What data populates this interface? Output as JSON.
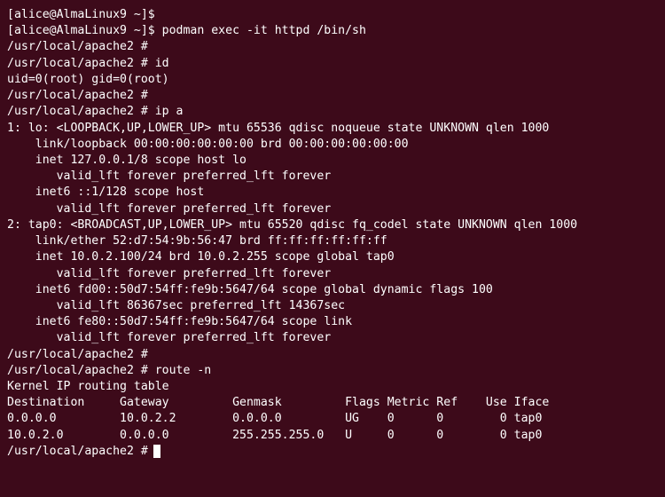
{
  "lines": [
    "[alice@AlmaLinux9 ~]$",
    "[alice@AlmaLinux9 ~]$ podman exec -it httpd /bin/sh",
    "/usr/local/apache2 #",
    "/usr/local/apache2 # id",
    "uid=0(root) gid=0(root)",
    "/usr/local/apache2 #",
    "/usr/local/apache2 # ip a",
    "1: lo: <LOOPBACK,UP,LOWER_UP> mtu 65536 qdisc noqueue state UNKNOWN qlen 1000",
    "    link/loopback 00:00:00:00:00:00 brd 00:00:00:00:00:00",
    "    inet 127.0.0.1/8 scope host lo",
    "       valid_lft forever preferred_lft forever",
    "    inet6 ::1/128 scope host",
    "       valid_lft forever preferred_lft forever",
    "2: tap0: <BROADCAST,UP,LOWER_UP> mtu 65520 qdisc fq_codel state UNKNOWN qlen 1000",
    "    link/ether 52:d7:54:9b:56:47 brd ff:ff:ff:ff:ff:ff",
    "    inet 10.0.2.100/24 brd 10.0.2.255 scope global tap0",
    "       valid_lft forever preferred_lft forever",
    "    inet6 fd00::50d7:54ff:fe9b:5647/64 scope global dynamic flags 100",
    "       valid_lft 86367sec preferred_lft 14367sec",
    "    inet6 fe80::50d7:54ff:fe9b:5647/64 scope link",
    "       valid_lft forever preferred_lft forever",
    "/usr/local/apache2 #",
    "/usr/local/apache2 # route -n",
    "Kernel IP routing table",
    "Destination     Gateway         Genmask         Flags Metric Ref    Use Iface",
    "0.0.0.0         10.0.2.2        0.0.0.0         UG    0      0        0 tap0",
    "10.0.2.0        0.0.0.0         255.255.255.0   U     0      0        0 tap0",
    "/usr/local/apache2 # "
  ]
}
